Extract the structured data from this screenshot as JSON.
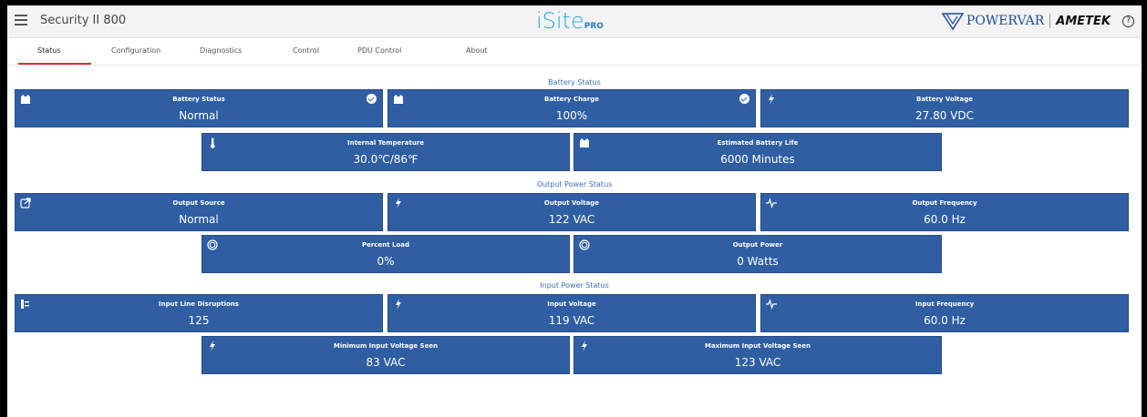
{
  "header": {
    "app_title": "Security II 800",
    "brand_main": "iSite",
    "brand_suffix": "PRO",
    "vendor_1": "POWERVAR",
    "vendor_2": "AMETEK",
    "help_glyph": "?"
  },
  "tabs": [
    {
      "label": "Status",
      "active": true
    },
    {
      "label": "Configuration"
    },
    {
      "label": "Diagnostics"
    },
    {
      "label": "Control"
    },
    {
      "label": "PDU Control"
    },
    {
      "label": "About"
    }
  ],
  "sections": {
    "battery": "Battery Status",
    "output": "Output Power Status",
    "input": "Input Power Status"
  },
  "cards": {
    "battery_status": {
      "label": "Battery Status",
      "value": "Normal",
      "icon": "battery-icon"
    },
    "battery_charge": {
      "label": "Battery Charge",
      "value": "100%",
      "icon": "battery-icon"
    },
    "battery_voltage": {
      "label": "Battery Voltage",
      "value": "27.80 VDC",
      "icon": "bolt-icon"
    },
    "internal_temp": {
      "label": "Internal Temperature",
      "value": "30.0℃/86℉",
      "icon": "thermometer-icon"
    },
    "est_battery_life": {
      "label": "Estimated Battery Life",
      "value": "6000 Minutes",
      "icon": "battery-icon"
    },
    "output_source": {
      "label": "Output Source",
      "value": "Normal",
      "icon": "output-source-icon"
    },
    "output_voltage": {
      "label": "Output Voltage",
      "value": "122 VAC",
      "icon": "bolt-icon"
    },
    "output_frequency": {
      "label": "Output Frequency",
      "value": "60.0 Hz",
      "icon": "pulse-icon"
    },
    "percent_load": {
      "label": "Percent Load",
      "value": "0%",
      "icon": "gauge-icon"
    },
    "output_power": {
      "label": "Output Power",
      "value": "0 Watts",
      "icon": "gauge-icon"
    },
    "input_line_disruptions": {
      "label": "Input Line Disruptions",
      "value": "125",
      "icon": "plug-icon"
    },
    "input_voltage": {
      "label": "Input Voltage",
      "value": "119 VAC",
      "icon": "bolt-icon"
    },
    "input_frequency": {
      "label": "Input Frequency",
      "value": "60.0 Hz",
      "icon": "pulse-icon"
    },
    "min_input_voltage": {
      "label": "Minimum Input Voltage Seen",
      "value": "83 VAC",
      "icon": "bolt-icon"
    },
    "max_input_voltage": {
      "label": "Maximum Input Voltage Seen",
      "value": "123 VAC",
      "icon": "bolt-icon"
    }
  },
  "colors": {
    "card_bg": "#2f5ea3",
    "section_title": "#3a6fb5",
    "active_tab_underline": "#dd3333",
    "brand": "#2aa8e0"
  }
}
